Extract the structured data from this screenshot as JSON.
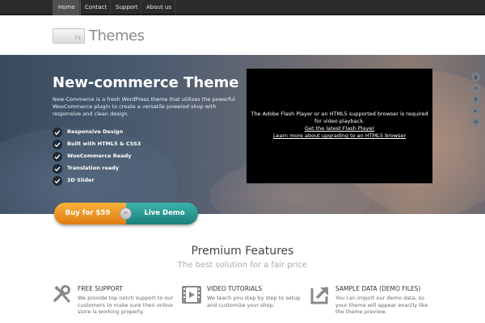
{
  "nav": {
    "items": [
      {
        "label": "Home",
        "active": true
      },
      {
        "label": "Contact",
        "active": false
      },
      {
        "label": "Support",
        "active": false
      },
      {
        "label": "About us",
        "active": false
      }
    ]
  },
  "logo": {
    "tag": "F5",
    "text": "Themes"
  },
  "hero": {
    "title": "New-commerce Theme",
    "description": "New-Commerce is a fresh WordPress theme that utilizes the powerful WooCommerce plugin to create a versatile powered shop with responsive and clean design.",
    "features": [
      "Responsive Design",
      "Built with HTML5 & CSS3",
      "WooCommerce Ready",
      "Translation ready",
      "3D Slider"
    ],
    "video": {
      "message": "The Adobe Flash Player or an HTML5 supported browser is required for video playback.",
      "link1": "Get the latest Flash Player",
      "link2": "Learn more about upgrading to an HTML5 browser"
    },
    "social_icons": [
      "google-plus-icon",
      "dribbble-icon",
      "twitter-icon",
      "youtube-icon",
      "rss-icon"
    ]
  },
  "cta": {
    "buy_label": "Buy for $59",
    "or_label": "or",
    "demo_label": "Live Demo"
  },
  "features_section": {
    "title": "Premium Features",
    "subtitle": "The best solution for a fair price",
    "items": [
      {
        "icon": "tools-icon",
        "title": "FREE SUPPORT",
        "text": "We provide top notch support to our customers to make sure their online store is working properly."
      },
      {
        "icon": "film-icon",
        "title": "VIDEO TUTORIALS",
        "text": "We teach you step by step to setup and customize your shop."
      },
      {
        "icon": "import-arrow-icon",
        "title": "SAMPLE DATA (DEMO FILES)",
        "text": "You can import our demo data, so your theme will appear exactly like the theme preview."
      }
    ]
  },
  "colors": {
    "nav_bg": "#2b2b2b",
    "buy_orange": "#e07c12",
    "demo_teal": "#1a7f79"
  }
}
